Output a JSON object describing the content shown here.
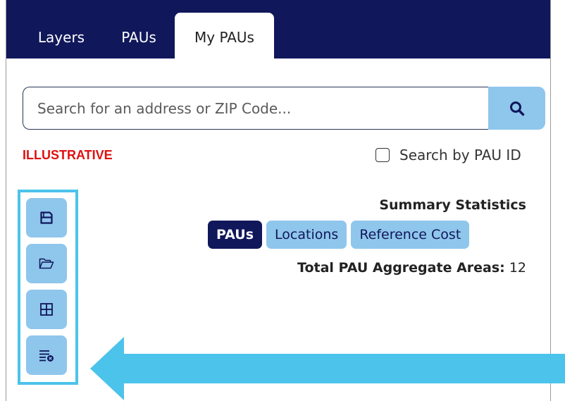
{
  "tabs": [
    {
      "label": "Layers",
      "active": false
    },
    {
      "label": "PAUs",
      "active": false
    },
    {
      "label": "My PAUs",
      "active": true
    }
  ],
  "search": {
    "placeholder": "Search for an address or ZIP Code...",
    "value": "",
    "button_icon": "search-icon"
  },
  "watermark": "ILLUSTRATIVE",
  "pau_id_checkbox": {
    "label": "Search by PAU ID",
    "checked": false
  },
  "toolbar": {
    "buttons": [
      {
        "icon": "save-icon"
      },
      {
        "icon": "folder-open-icon"
      },
      {
        "icon": "grid-icon"
      },
      {
        "icon": "clear-list-icon"
      }
    ]
  },
  "summary": {
    "title": "Summary Statistics",
    "tabs": [
      {
        "label": "PAUs",
        "active": true
      },
      {
        "label": "Locations",
        "active": false
      },
      {
        "label": "Reference Cost",
        "active": false
      }
    ],
    "total_label": "Total PAU Aggregate Areas:",
    "total_value": "12"
  },
  "colors": {
    "navy": "#10175a",
    "light_blue": "#8fc6ec",
    "highlight": "#4cc3ea",
    "watermark_red": "#e01010"
  }
}
